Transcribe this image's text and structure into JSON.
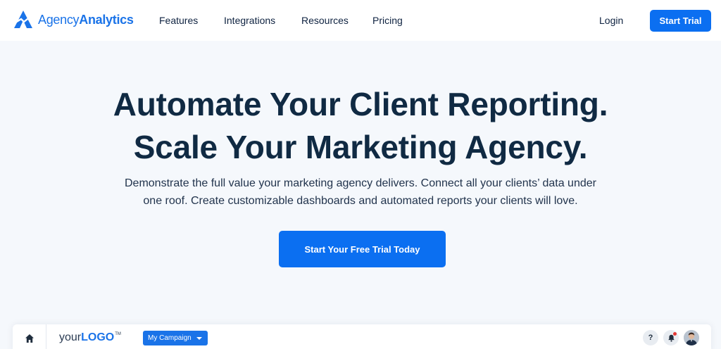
{
  "brand": {
    "name_part1": "Agency",
    "name_part2": "Analytics",
    "logo_icon": "agencyanalytics-logo-mark",
    "accent_color": "#1a73e8"
  },
  "nav": {
    "links": [
      "Features",
      "Integrations",
      "Resources",
      "Pricing"
    ],
    "login": "Login",
    "trial_button": "Start Trial"
  },
  "hero": {
    "title_line1": "Automate Your Client Reporting.",
    "title_line2": "Scale Your Marketing Agency.",
    "subtitle_line1": "Demonstrate the full value your marketing agency delivers. Connect all your clients’ data under",
    "subtitle_line2": "one roof. Create customizable dashboards and automated reports your clients will love.",
    "cta": "Start Your Free Trial Today",
    "cta_color": "#0b6ff1"
  },
  "preview": {
    "home_icon": "home-icon",
    "logo_prefix": "your",
    "logo_bold": "LOGO",
    "logo_tm": "TM",
    "campaign_select": "My Campaign",
    "help_icon_label": "?",
    "bell_icon": "bell-icon",
    "avatar_icon": "user-avatar"
  }
}
